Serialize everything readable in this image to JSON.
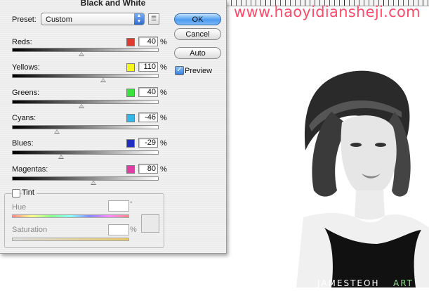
{
  "dialog": {
    "title": "Black and White",
    "preset": {
      "label": "Preset:",
      "value": "Custom"
    },
    "buttons": {
      "ok": "OK",
      "cancel": "Cancel",
      "auto": "Auto"
    },
    "preview": {
      "label": "Preview",
      "checked": true
    },
    "sliders": [
      {
        "label": "Reds:",
        "value": "40",
        "unit": "%",
        "swatch_color": "#e03a2f",
        "level": 0.48
      },
      {
        "label": "Yellows:",
        "value": "110",
        "unit": "%",
        "swatch_color": "#f5f51f",
        "level": 0.63
      },
      {
        "label": "Greens:",
        "value": "40",
        "unit": "%",
        "swatch_color": "#39e23d",
        "level": 0.48
      },
      {
        "label": "Cyans:",
        "value": "-46",
        "unit": "%",
        "swatch_color": "#33b7e6",
        "level": 0.31
      },
      {
        "label": "Blues:",
        "value": "-29",
        "unit": "%",
        "swatch_color": "#1f2fc4",
        "level": 0.34
      },
      {
        "label": "Magentas:",
        "value": "80",
        "unit": "%",
        "swatch_color": "#e03ea5",
        "level": 0.56
      }
    ],
    "tint": {
      "label": "Tint",
      "checked": false,
      "hue_label": "Hue",
      "hue_unit": "°",
      "saturation_label": "Saturation",
      "saturation_unit": "%"
    }
  },
  "canvas": {
    "watermark": "www.haoyidiansheji.com",
    "signature_white": "JAMESTEOH",
    "signature_green": "ART"
  }
}
